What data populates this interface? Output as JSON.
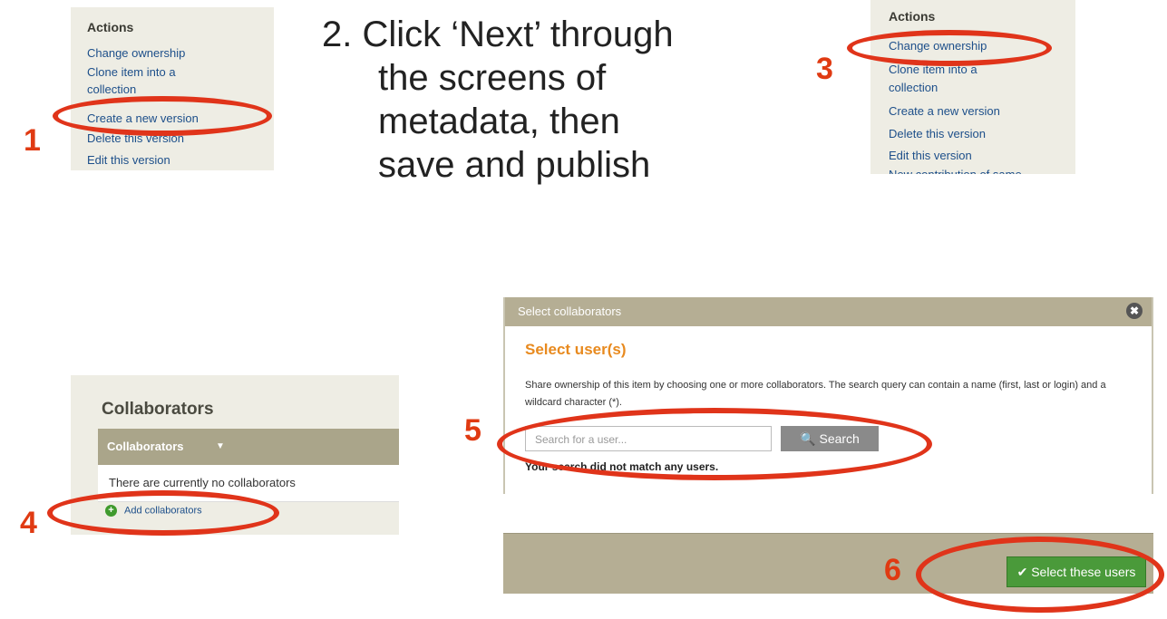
{
  "panel1": {
    "heading": "Actions",
    "items": [
      "Change ownership",
      "Clone item into a",
      "collection",
      "Create a new version",
      "Delete this version",
      "Edit this version"
    ]
  },
  "panel3": {
    "heading": "Actions",
    "items": [
      "Change ownership",
      "Clone item into a",
      "collection",
      "Create a new version",
      "Delete this version",
      "Edit this version",
      "New contribution of same"
    ]
  },
  "instructions": {
    "lines": [
      "2. Click ‘Next’ through",
      "the screens of",
      "metadata, then",
      "save and publish"
    ]
  },
  "steps": [
    "1",
    "3",
    "4",
    "5",
    "6"
  ],
  "collaborators": {
    "title": "Collaborators",
    "bar_label": "Collaborators",
    "bar_arrow": "▼",
    "empty": "There are currently no collaborators",
    "add": "Add collaborators"
  },
  "dialog": {
    "title": "Select collaborators",
    "close": "✖",
    "subtitle": "Select user(s)",
    "description": "Share ownership of this item by choosing one or more collaborators. The search query can contain a name (first, last or login) and a wildcard character (*).",
    "search_placeholder": "Search for a user...",
    "search_button": "🔍 Search",
    "no_match": "Your search did not match any users."
  },
  "footer": {
    "button": "✔ Select these users"
  },
  "colors": {
    "accent_red": "#e0341a",
    "orange": "#e88a1f",
    "green": "#4a9a3a"
  }
}
